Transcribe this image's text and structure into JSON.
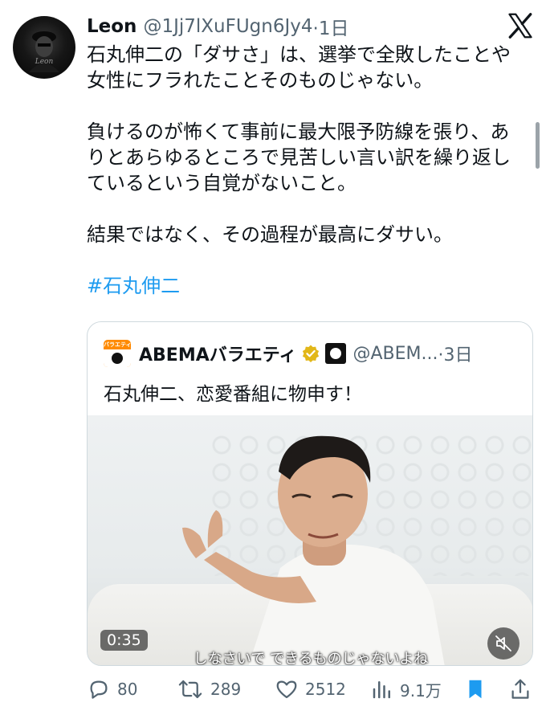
{
  "tweet": {
    "author_name": "Leon",
    "author_handle": "@1Jj7lXuFUgn6Jy4",
    "time": "·1日",
    "avatar_signature": "Leon",
    "paragraphs": [
      "石丸伸二の「ダサさ」は、選挙で全敗したことや\n女性にフラれたことそのものじゃない。",
      "負けるのが怖くて事前に最大限予防線を張り、あ\nりとあらゆるところで見苦しい言い訳を繰り返し\nているという自覚がないこと。",
      "結果ではなく、その過程が最高にダサい。"
    ],
    "hashtag": "#石丸伸二"
  },
  "quote": {
    "logo_text": "バラエティ",
    "name": "ABEMAバラエティ",
    "handle": "@ABEM...",
    "time": "·3日",
    "text": "石丸伸二、恋愛番組に物申す！",
    "video": {
      "duration": "0:35",
      "subtitle": "しなさいで できるものじゃないよね"
    }
  },
  "actions": {
    "replies": "80",
    "retweets": "289",
    "likes": "2512",
    "views": "9.1万"
  },
  "colors": {
    "link": "#1d9bf0",
    "muted": "#536471",
    "bookmark_active": "#1d9bf0"
  },
  "icons": [
    "x-logo-icon",
    "verified-badge-icon",
    "reply-icon",
    "retweet-icon",
    "like-icon",
    "views-icon",
    "bookmark-icon",
    "share-icon",
    "mute-icon"
  ]
}
